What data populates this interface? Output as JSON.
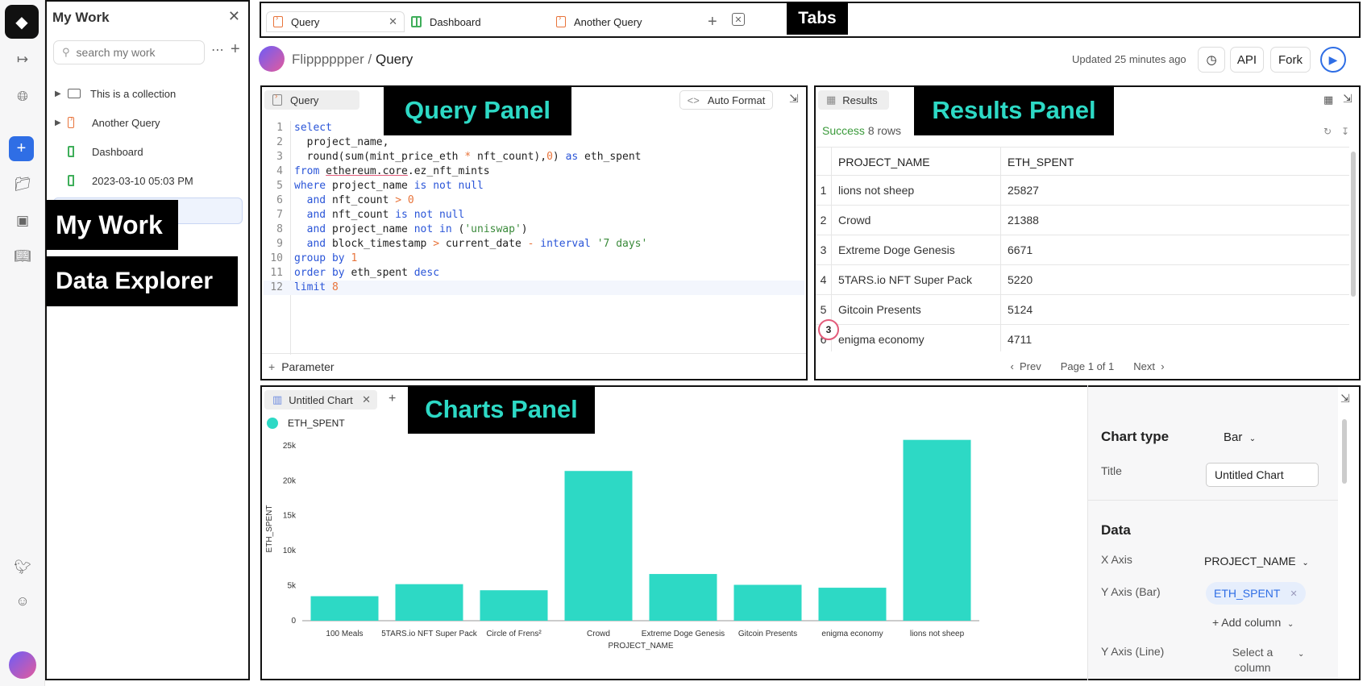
{
  "rail": {
    "icons": [
      "logo-icon",
      "collapse-icon",
      "globe-icon",
      "plus-icon",
      "folder-icon",
      "database-icon",
      "book-icon",
      "twitter-icon",
      "discord-icon"
    ]
  },
  "mywork": {
    "title": "My Work",
    "search_placeholder": "search my work",
    "items": [
      {
        "label": "This is a collection",
        "type": "collection"
      },
      {
        "label": "Another Query",
        "type": "query"
      },
      {
        "label": "Dashboard",
        "type": "dashboard"
      },
      {
        "label": "2023-03-10 05:03 PM",
        "type": "dashboard"
      }
    ]
  },
  "annotations": {
    "my_work": "My Work",
    "data_explorer": "Data Explorer",
    "tabs": "Tabs",
    "query_panel": "Query Panel",
    "results_panel": "Results Panel",
    "charts_panel": "Charts Panel",
    "marker": "3"
  },
  "tabs": [
    {
      "label": "Query",
      "type": "query"
    },
    {
      "label": "Dashboard",
      "type": "dashboard"
    },
    {
      "label": "Another Query",
      "type": "query"
    }
  ],
  "header": {
    "owner": "Flipppppper",
    "separator": "/",
    "title": "Query",
    "updated": "Updated 25 minutes ago",
    "api": "API",
    "fork": "Fork"
  },
  "query_panel": {
    "tab": "Query",
    "auto_format": "Auto Format",
    "parameter": "Parameter",
    "lines": [
      "select",
      "  project_name,",
      "  round(sum(mint_price_eth * nft_count),0) as eth_spent",
      "from ethereum.core.ez_nft_mints",
      "where project_name is not null",
      "  and nft_count > 0",
      "  and nft_count is not null",
      "  and project_name not in ('uniswap')",
      "  and block_timestamp > current_date - interval '7 days'",
      "group by 1",
      "order by eth_spent desc",
      "limit 8"
    ]
  },
  "results_panel": {
    "tab": "Results",
    "status": "Success",
    "rows_text": "8 rows",
    "columns": [
      "PROJECT_NAME",
      "ETH_SPENT"
    ],
    "rows": [
      [
        "1",
        "lions not sheep",
        "25827"
      ],
      [
        "2",
        "Crowd",
        "21388"
      ],
      [
        "3",
        "Extreme Doge Genesis",
        "6671"
      ],
      [
        "4",
        "5TARS.io NFT Super Pack",
        "5220"
      ],
      [
        "5",
        "Gitcoin Presents",
        "5124"
      ],
      [
        "6",
        "enigma economy",
        "4711"
      ]
    ],
    "prev": "Prev",
    "page": "Page 1 of 1",
    "next": "Next"
  },
  "charts_panel": {
    "tab": "Untitled Chart",
    "legend": "ETH_SPENT",
    "settings": {
      "chart_type_label": "Chart type",
      "chart_type": "Bar",
      "title_label": "Title",
      "title_value": "Untitled Chart",
      "data_heading": "Data",
      "x_axis_label": "X Axis",
      "x_axis_value": "PROJECT_NAME",
      "y_bar_label": "Y Axis (Bar)",
      "y_bar_value": "ETH_SPENT",
      "add_column": "+ Add column",
      "y_line_label": "Y Axis (Line)",
      "y_line_value": "Select a column"
    }
  },
  "colors": {
    "bar": "#2dd9c5",
    "accent": "#2f6ee5",
    "success": "#3a9a3a"
  },
  "chart_data": {
    "type": "bar",
    "categories": [
      "100 Meals",
      "5TARS.io NFT Super Pack",
      "Circle of Frens²",
      "Crowd",
      "Extreme Doge Genesis",
      "Gitcoin Presents",
      "enigma economy",
      "lions not sheep"
    ],
    "series": [
      {
        "name": "ETH_SPENT",
        "values": [
          3500,
          5220,
          4350,
          21388,
          6671,
          5124,
          4711,
          25827
        ]
      }
    ],
    "xlabel": "PROJECT_NAME",
    "ylabel": "ETH_SPENT",
    "ylim": [
      0,
      25000
    ],
    "yticks": [
      "0",
      "5k",
      "10k",
      "15k",
      "20k",
      "25k"
    ],
    "legend_position": "top-left",
    "grid": false
  }
}
